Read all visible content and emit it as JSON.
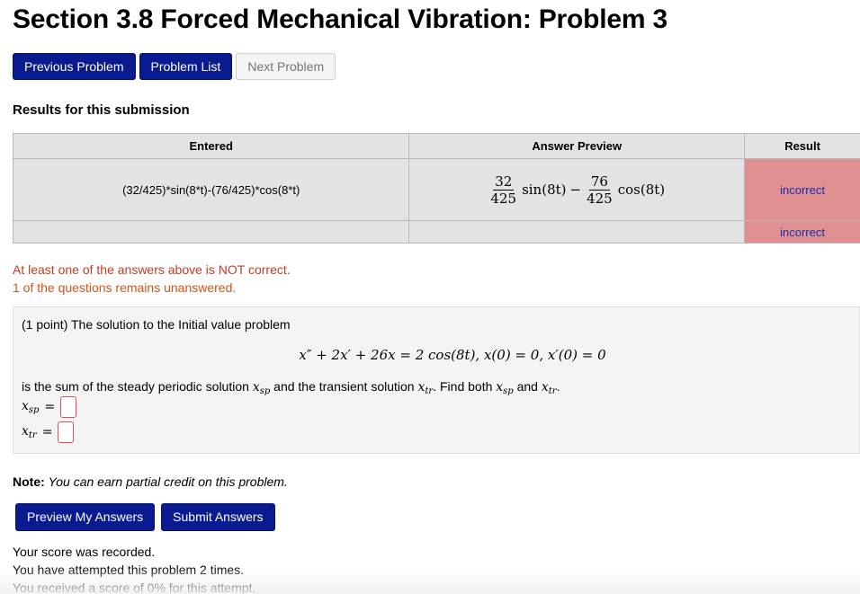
{
  "page": {
    "title": "Section 3.8 Forced Mechanical Vibration: Problem 3"
  },
  "nav": {
    "previous": "Previous Problem",
    "list": "Problem List",
    "next": "Next Problem"
  },
  "results": {
    "heading": "Results for this submission",
    "columns": [
      "Entered",
      "Answer Preview",
      "Result"
    ],
    "rows": [
      {
        "entered": "(32/425)*sin(8*t)-(76/425)*cos(8*t)",
        "preview": {
          "frac1_num": "32",
          "frac1_den": "425",
          "term1": "sin(8t)",
          "op": "−",
          "frac2_num": "76",
          "frac2_den": "425",
          "term2": "cos(8t)"
        },
        "result": "incorrect"
      },
      {
        "entered": "",
        "result": "incorrect"
      }
    ]
  },
  "messages": {
    "not_correct": "At least one of the answers above is NOT correct.",
    "unanswered": "1 of the questions remains unanswered."
  },
  "problem": {
    "intro": "(1 point) The solution to the Initial value problem",
    "equation": "x″ + 2x′ + 26x = 2 cos(8t),    x(0) = 0, x′(0) = 0",
    "desc_a": "is the sum of the steady periodic solution ",
    "desc_b": " and the transient solution ",
    "desc_c": ". Find both ",
    "desc_d": " and ",
    "desc_e": ".",
    "x_sym": "x",
    "sp": "sp",
    "tr": "tr",
    "eq_sign": "="
  },
  "note": {
    "label": "Note:",
    "text": "You can earn partial credit on this problem."
  },
  "actions": {
    "preview": "Preview My Answers",
    "submit": "Submit Answers"
  },
  "status": {
    "recorded": "Your score was recorded.",
    "attempted": "You have attempted this problem 2 times.",
    "score": "You received a score of 0% for this attempt."
  },
  "colors": {
    "primary_button": "#0a1a8f",
    "incorrect_bg": "#e09090",
    "error_text": "#c23b22"
  }
}
